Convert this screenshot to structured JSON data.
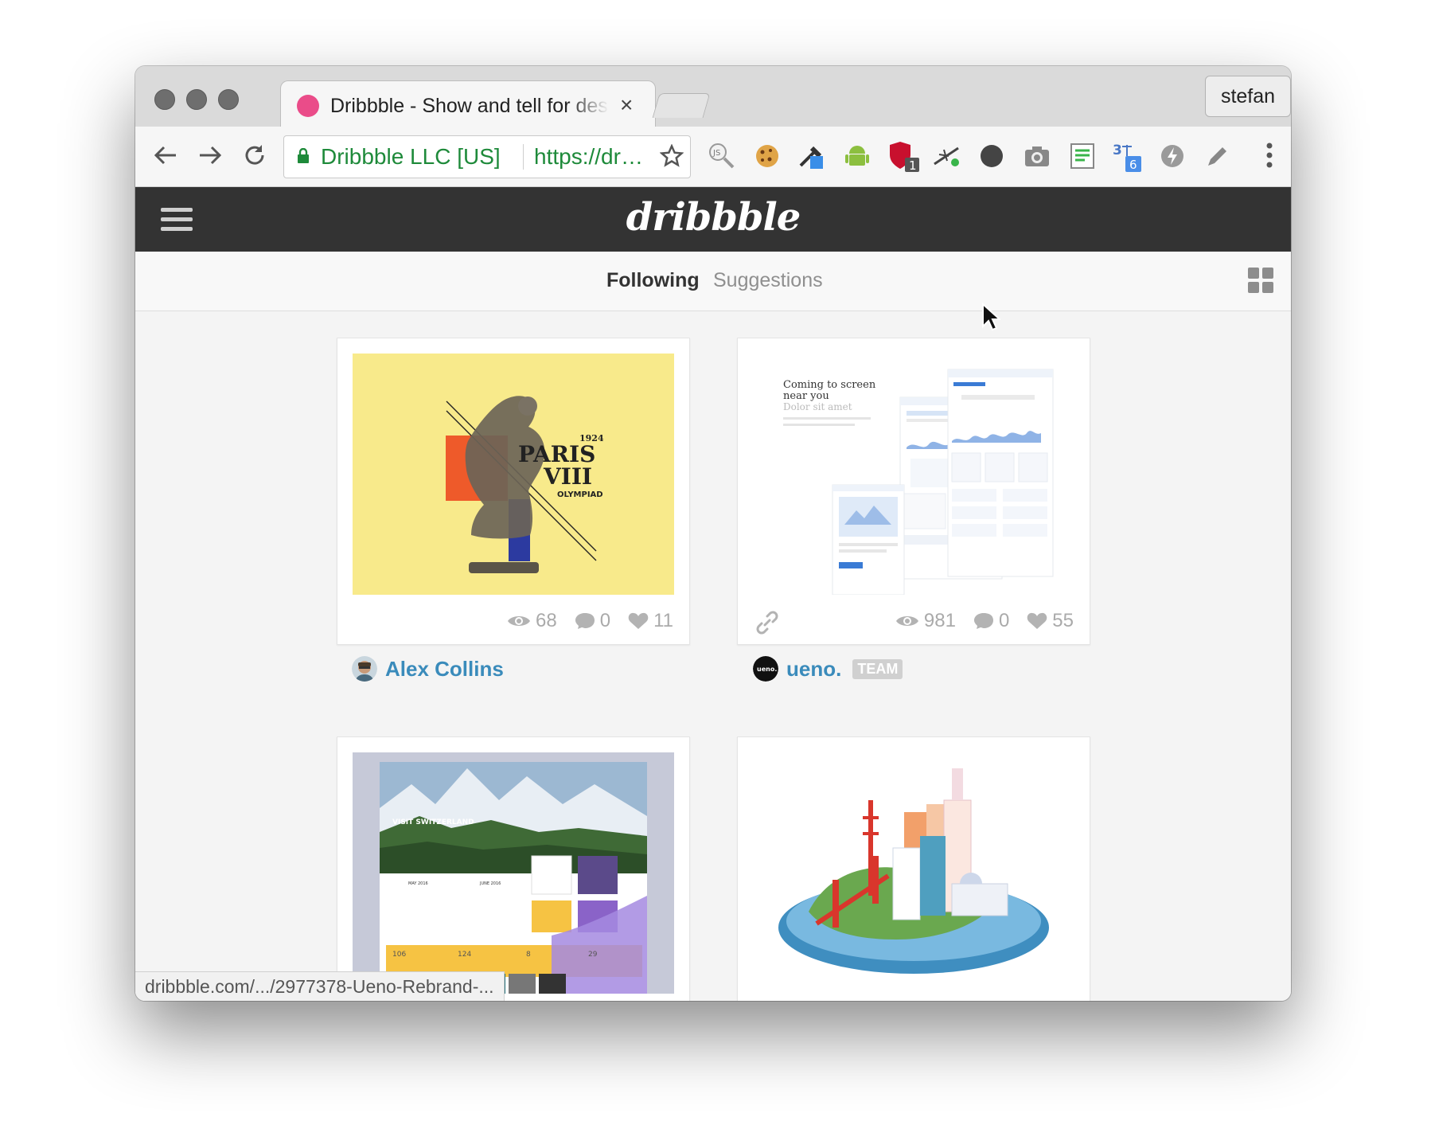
{
  "browser": {
    "tab_title": "Dribbble - Show and tell for designers",
    "tab_close": "×",
    "profile_name": "stefan",
    "origin_label": "Dribbble LLC [US]",
    "url": "https://dr…",
    "status_url": "dribbble.com/.../2977378-Ueno-Rebrand-...",
    "extensions": [
      {
        "icon": "js-search-icon"
      },
      {
        "icon": "cookie-icon"
      },
      {
        "icon": "eyedropper-icon"
      },
      {
        "icon": "android-icon"
      },
      {
        "icon": "ublock-icon",
        "badge": "1"
      },
      {
        "icon": "wand-icon"
      },
      {
        "icon": "circle-icon"
      },
      {
        "icon": "camera-icon"
      },
      {
        "icon": "document-icon"
      },
      {
        "icon": "translate-icon",
        "badge": "6"
      },
      {
        "icon": "lightning-icon"
      },
      {
        "icon": "pencil-icon"
      }
    ]
  },
  "site": {
    "logo": "dribbble",
    "tabs": [
      {
        "label": "Following",
        "active": true
      },
      {
        "label": "Suggestions",
        "active": false
      }
    ]
  },
  "shots": [
    {
      "views": "68",
      "comments": "0",
      "likes": "11",
      "author": "Alex Collins",
      "art": {
        "year": "1924",
        "line1": "PARIS",
        "line2": "VIII",
        "line3": "OLYMPIAD"
      }
    },
    {
      "views": "981",
      "comments": "0",
      "likes": "55",
      "author": "ueno.",
      "badge": "TEAM",
      "has_link": true,
      "art": {
        "heading1": "Coming to screen",
        "heading2": "near you",
        "sub": "Dolor sit amet"
      }
    },
    {
      "art": {
        "headline": "VISIT SWITZERLAND",
        "month1": "MAY 2016",
        "month2": "JUNE 2016",
        "stat1": "106",
        "stat2": "124",
        "stat3": "8",
        "stat4": "29"
      }
    },
    {
      "art": {}
    }
  ],
  "colors": {
    "accent": "#ea4c89",
    "author_link": "#3a8bbb",
    "header": "#333333",
    "secure_green": "#1e8a3a"
  }
}
